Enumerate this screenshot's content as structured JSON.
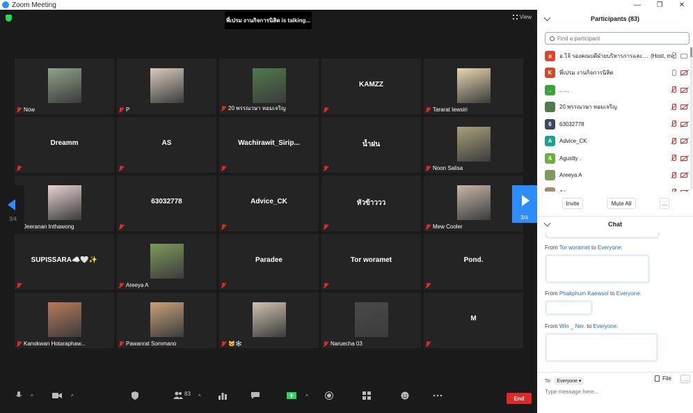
{
  "window": {
    "title": "Zoom Meeting"
  },
  "meeting": {
    "talking_banner": "พี่เปรม งานกิจการนิสิต is talking...",
    "view_label": "View",
    "page_indicator": "3/4"
  },
  "tiles": [
    {
      "name": "Now",
      "big": "",
      "photo": "#8fa38a"
    },
    {
      "name": "P",
      "big": "",
      "photo": "#d9cbbd"
    },
    {
      "name": "20 พรรณวษา หอมเจริญ",
      "big": "",
      "photo": "#4f7a4a"
    },
    {
      "name": "",
      "big": "KAMZZ",
      "photo": ""
    },
    {
      "name": "Tararat Iewsiri",
      "big": "",
      "photo": "#e8d6b0"
    },
    {
      "name": "",
      "big": "Dreamm",
      "photo": ""
    },
    {
      "name": "",
      "big": "AS",
      "photo": ""
    },
    {
      "name": "",
      "big": "Wachirawit_Sirip...",
      "photo": ""
    },
    {
      "name": "",
      "big": "น้ำฝน",
      "photo": ""
    },
    {
      "name": "Noon Salisa",
      "big": "",
      "photo": "#a9a07a"
    },
    {
      "name": "Jeeranan Inthawong",
      "big": "",
      "photo": "#e8d4d4"
    },
    {
      "name": "",
      "big": "63032778",
      "photo": ""
    },
    {
      "name": "",
      "big": "Advice_CK",
      "photo": ""
    },
    {
      "name": "",
      "big": "หัวข้าววว",
      "photo": ""
    },
    {
      "name": "Mew Cooler",
      "big": "",
      "photo": "#c9b6a8"
    },
    {
      "name": "",
      "big": "SUPISSARA☁️🤍✨",
      "photo": ""
    },
    {
      "name": "Areeya A",
      "big": "",
      "photo": "#7f9a5c"
    },
    {
      "name": "",
      "big": "Paradee",
      "photo": ""
    },
    {
      "name": "",
      "big": "Tor woramet",
      "photo": ""
    },
    {
      "name": "",
      "big": "Pond.",
      "photo": ""
    },
    {
      "name": "Kanokwan Hotaraphaw...",
      "big": "",
      "photo": "#b87a5a"
    },
    {
      "name": "Pawanrat Sommano",
      "big": "",
      "photo": "#c9a27a"
    },
    {
      "name": "🐱❄️",
      "big": "",
      "photo": "#cfc2b0"
    },
    {
      "name": "Naruecha 03",
      "big": "",
      "photo": "#4a4a4a"
    },
    {
      "name": "",
      "big": "M",
      "photo": ""
    }
  ],
  "toolbar": {
    "participants_count": "83",
    "end_label": "End"
  },
  "participants": {
    "header": "Participants (83)",
    "search_placeholder": "Find a participant",
    "host_tag": "(Host, me)",
    "items": [
      {
        "initial": "อ",
        "color": "#e0452b",
        "name": "อ.โจ้ รองคณบดีฝ่ายบริหารการและพัฒนา...",
        "host": true,
        "mic_muted": false,
        "cam_muted": false
      },
      {
        "initial": "K",
        "color": "#d9491f",
        "name": "พี่เปรม งานกิจการนิสิต",
        "host": false,
        "mic_muted": false,
        "cam_muted": true
      },
      {
        "initial": "..",
        "color": "#3aa536",
        "name": ".. ...",
        "host": false,
        "mic_muted": true,
        "cam_muted": true
      },
      {
        "initial": "",
        "color": "#4f7a4a",
        "name": "20 พรรณวษา หอมเจริญ",
        "host": false,
        "mic_muted": true,
        "cam_muted": true
      },
      {
        "initial": "6",
        "color": "#3a4a5e",
        "name": "63032778",
        "host": false,
        "mic_muted": true,
        "cam_muted": true
      },
      {
        "initial": "A",
        "color": "#1aa38c",
        "name": "Advice_CK",
        "host": false,
        "mic_muted": true,
        "cam_muted": true
      },
      {
        "initial": "A",
        "color": "#6bb13b",
        "name": "Agustty .",
        "host": false,
        "mic_muted": true,
        "cam_muted": true
      },
      {
        "initial": "",
        "color": "#7f9a5c",
        "name": "Areeya A",
        "host": false,
        "mic_muted": true,
        "cam_muted": true
      },
      {
        "initial": "",
        "color": "#a08c70",
        "name": "Ari",
        "host": false,
        "mic_muted": true,
        "cam_muted": true
      }
    ],
    "invite_label": "Invite",
    "mute_all_label": "Mute All",
    "more_label": "..."
  },
  "chat": {
    "header": "Chat",
    "from_label": "From",
    "to_label": "to",
    "messages": [
      {
        "sender": "Tor woramet",
        "recipient": "Everyone:"
      },
      {
        "sender": "Phakphum Kaewsol",
        "recipient": "Everyone:"
      },
      {
        "sender": "Win _ Ner.",
        "recipient": "Everyone:"
      }
    ],
    "to_prefix": "To:",
    "to_value": "Everyone",
    "file_label": "File",
    "more_label": "...",
    "input_placeholder": "Type message here..."
  },
  "colors": {
    "accent": "#2d8cff",
    "muted_red": "#e02828",
    "end_red": "#e02828"
  }
}
